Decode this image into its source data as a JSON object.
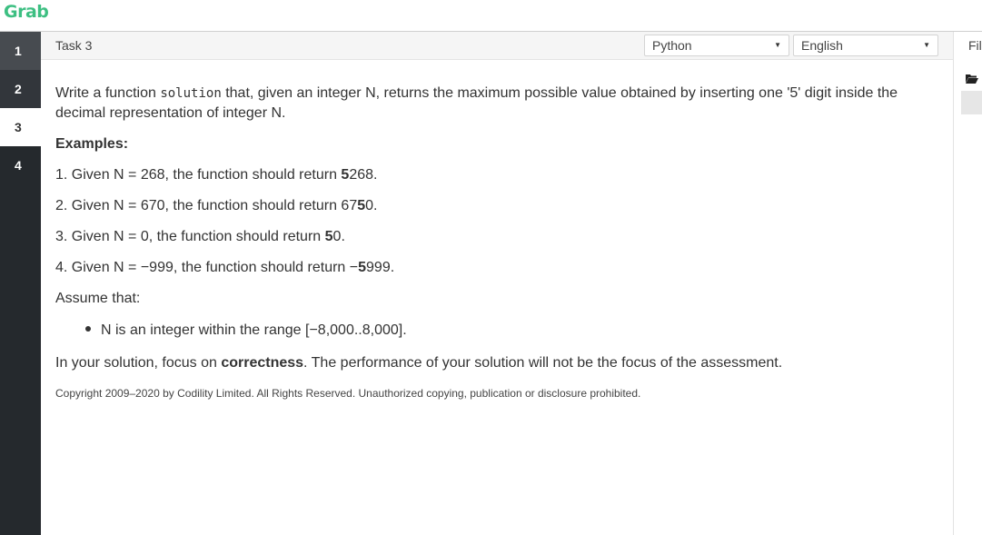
{
  "app": {
    "logo": "Grab"
  },
  "sidebar": {
    "tabs": [
      "1",
      "2",
      "3",
      "4"
    ],
    "active": "3"
  },
  "header": {
    "task_title": "Task 3",
    "language_select": "Python",
    "human_language_select": "English"
  },
  "files_panel": {
    "label": "Files"
  },
  "problem": {
    "intro_before": "Write a function ",
    "intro_code": "solution",
    "intro_after": " that, given an integer N, returns the maximum possible value obtained by inserting one '5' digit inside the decimal representation of integer N.",
    "examples_heading": "Examples:",
    "examples": [
      {
        "prefix": "1. Given N = 268, the function should return ",
        "before": "",
        "bold": "5",
        "after": "268",
        "end": "."
      },
      {
        "prefix": "2. Given N = 670, the function should return ",
        "before": "67",
        "bold": "5",
        "after": "0",
        "end": "."
      },
      {
        "prefix": "3. Given N = 0, the function should return ",
        "before": "",
        "bold": "5",
        "after": "0",
        "end": "."
      },
      {
        "prefix": "4. Given N = −999, the function should return −",
        "before": "",
        "bold": "5",
        "after": "999",
        "end": "."
      }
    ],
    "assume_heading": "Assume that:",
    "assumption": "N is an integer within the range [−8,000..8,000].",
    "focus_before": "In your solution, focus on ",
    "focus_bold": "correctness",
    "focus_after": ". The performance of your solution will not be the focus of the assessment.",
    "copyright": "Copyright 2009–2020 by Codility Limited. All Rights Reserved. Unauthorized copying, publication or disclosure prohibited."
  },
  "colors": {
    "brand": "#3dbf82",
    "sidebar_bg": "#25292d"
  },
  "icons": {
    "folder": "folder-open-icon",
    "caret": "caret-down-icon"
  }
}
